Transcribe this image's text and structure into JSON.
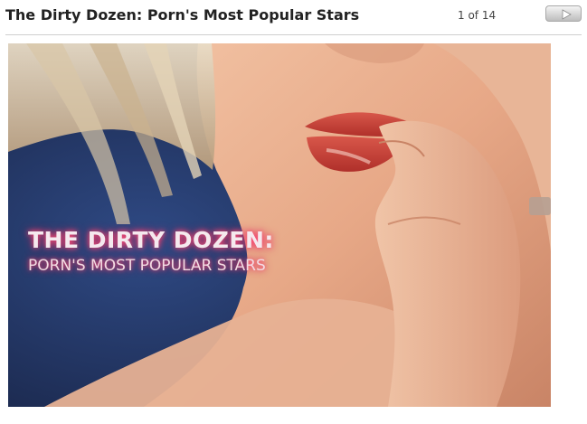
{
  "header": {
    "title": "The Dirty Dozen: Porn's Most Popular Stars",
    "counter": "1 of 14",
    "next_icon": "play-triangle-icon"
  },
  "slide": {
    "headline": "THE DIRTY DOZEN:",
    "subheadline": "PORN'S MOST POPULAR STARS",
    "colors": {
      "background": "#1f2c52",
      "text_glow": "#ff4f7a"
    }
  }
}
